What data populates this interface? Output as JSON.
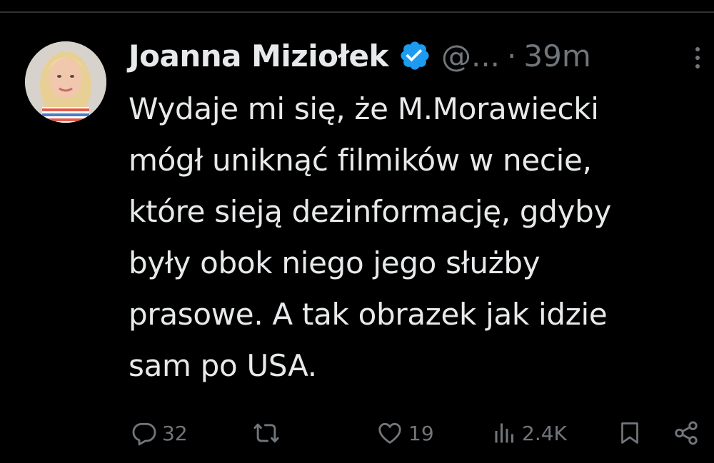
{
  "tweet": {
    "author": {
      "display_name": "Joanna Miziołek",
      "handle": "@...",
      "verified": true
    },
    "separator": "·",
    "timestamp": "39m",
    "text_lines": [
      "Wydaje mi się, że M.Morawiecki",
      "mógł uniknąć filmików w necie,",
      "które sieją dezinformację, gdyby",
      "były obok niego jego służby",
      "prasowe. A tak obrazek jak idzie",
      "sam po USA."
    ],
    "metrics": {
      "replies": "32",
      "retweets": "",
      "likes": "19",
      "views": "2.4K"
    }
  },
  "icons": {
    "verified": "verified-badge-icon",
    "more": "more-options-icon",
    "reply": "reply-icon",
    "retweet": "retweet-icon",
    "like": "heart-icon",
    "views": "views-chart-icon",
    "bookmark": "bookmark-icon",
    "share": "share-icon"
  },
  "colors": {
    "background": "#000000",
    "primary_text": "#e7e9ea",
    "secondary_text": "#71767b",
    "verified_blue": "#1d9bf0",
    "divider": "#2f3336"
  }
}
